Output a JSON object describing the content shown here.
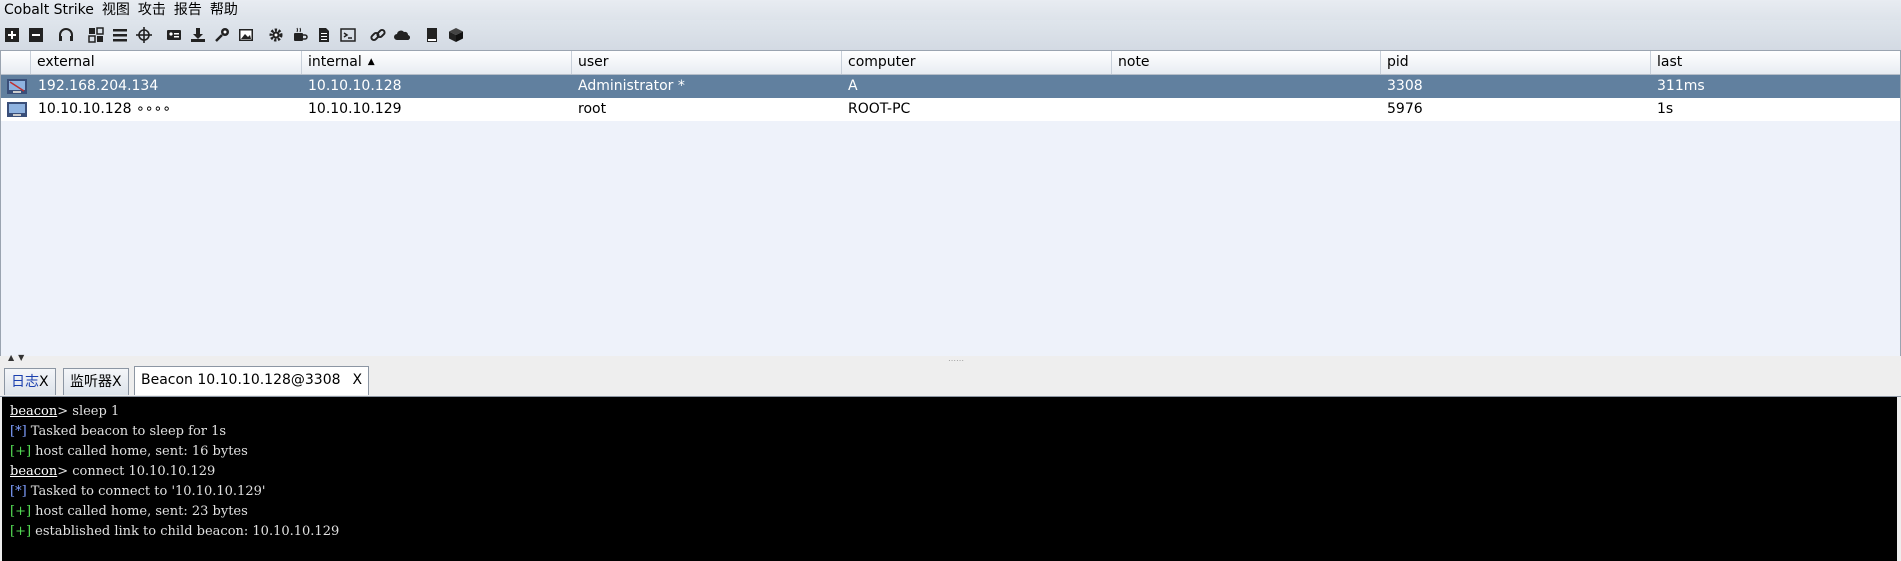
{
  "menu": [
    "Cobalt Strike",
    "视图",
    "攻击",
    "报告",
    "帮助"
  ],
  "toolbar": {
    "groups": [
      [
        "new-connection-icon",
        "disconnect-icon"
      ],
      [
        "headset-icon"
      ],
      [
        "pivot-graph-icon",
        "session-table-icon",
        "target-icon"
      ],
      [
        "credentials-icon",
        "download-icon",
        "key-icon",
        "screenshot-icon"
      ],
      [
        "gear-icon",
        "coffee-icon",
        "document-icon",
        "console-icon"
      ],
      [
        "link-icon",
        "cloud-icon"
      ],
      [
        "book-icon",
        "package-icon"
      ]
    ]
  },
  "table": {
    "columns": [
      "external",
      "internal",
      "user",
      "computer",
      "note",
      "pid",
      "last"
    ],
    "sort_column": "internal",
    "rows": [
      {
        "external": "192.168.204.134",
        "internal": "10.10.10.128",
        "user": "Administrator *",
        "computer": "A",
        "note": "",
        "pid": "3308",
        "last": "311ms",
        "selected": true
      },
      {
        "external": "10.10.10.128 ∘∘∘∘",
        "internal": "10.10.10.129",
        "user": "root",
        "computer": "ROOT-PC",
        "note": "",
        "pid": "5976",
        "last": "1s",
        "selected": false
      }
    ]
  },
  "tabs": [
    {
      "label": "日志",
      "close": "X",
      "active": false
    },
    {
      "label": "监听器",
      "close": "X",
      "active": false
    },
    {
      "label": "Beacon 10.10.10.128@3308",
      "close": "X",
      "active": true
    }
  ],
  "console": {
    "lines": [
      {
        "type": "prompt",
        "prefix": "beacon",
        "text": "> sleep 1"
      },
      {
        "type": "star",
        "prefix": "[*]",
        "text": " Tasked beacon to sleep for 1s"
      },
      {
        "type": "plus",
        "prefix": "[+]",
        "text": " host called home, sent: 16 bytes"
      },
      {
        "type": "prompt",
        "prefix": "beacon",
        "text": "> connect 10.10.10.129"
      },
      {
        "type": "star",
        "prefix": "[*]",
        "text": " Tasked to connect to '10.10.10.129'"
      },
      {
        "type": "plus",
        "prefix": "[+]",
        "text": " host called home, sent: 23 bytes"
      },
      {
        "type": "plus",
        "prefix": "[+]",
        "text": " established link to child beacon: 10.10.10.129"
      }
    ]
  },
  "colors": {
    "selected_row": "#61809f",
    "console_bg": "#000000",
    "star": "#7f9fff",
    "plus": "#55dd55"
  }
}
